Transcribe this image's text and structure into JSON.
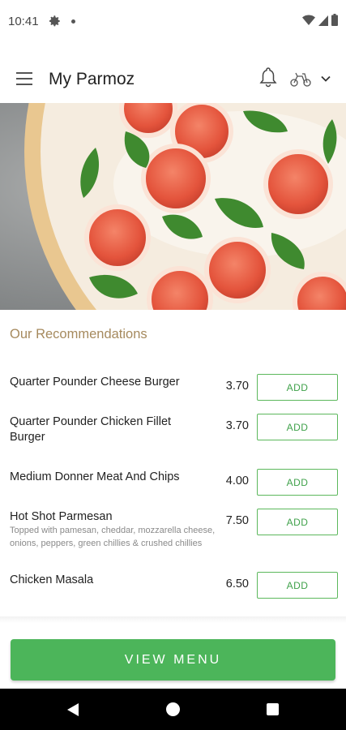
{
  "status_bar": {
    "time": "10:41",
    "icons": [
      "gear-icon",
      "notification-dot-icon",
      "wifi-icon",
      "signal-icon",
      "battery-icon"
    ]
  },
  "app_bar": {
    "title": "My Parmoz",
    "icons": [
      "menu-icon",
      "bell-icon",
      "scooter-icon",
      "chevron-down-icon"
    ]
  },
  "hero": {
    "image": "pizza-with-tomato-and-basil"
  },
  "recommendations": {
    "title": "Our Recommendations",
    "add_label": "ADD",
    "items": [
      {
        "name": "Quarter Pounder Cheese Burger",
        "description": "",
        "price": "3.70"
      },
      {
        "name": "Quarter Pounder Chicken Fillet Burger",
        "description": "",
        "price": "3.70"
      },
      {
        "name": "Medium Donner Meat And Chips",
        "description": "",
        "price": "4.00"
      },
      {
        "name": "Hot Shot Parmesan",
        "description": "Topped with pamesan, cheddar, mozzarella cheese, onions, peppers, green chillies & crushed chillies",
        "price": "7.50"
      },
      {
        "name": "Chicken Masala",
        "description": "",
        "price": "6.50"
      }
    ]
  },
  "view_menu_label": "VIEW MENU",
  "colors": {
    "accent_green": "#4cb55a",
    "section_title": "#a68a5e",
    "add_border": "#5cb85c"
  },
  "nav_bar": {
    "icons": [
      "back-icon",
      "home-icon",
      "recent-apps-icon"
    ]
  }
}
